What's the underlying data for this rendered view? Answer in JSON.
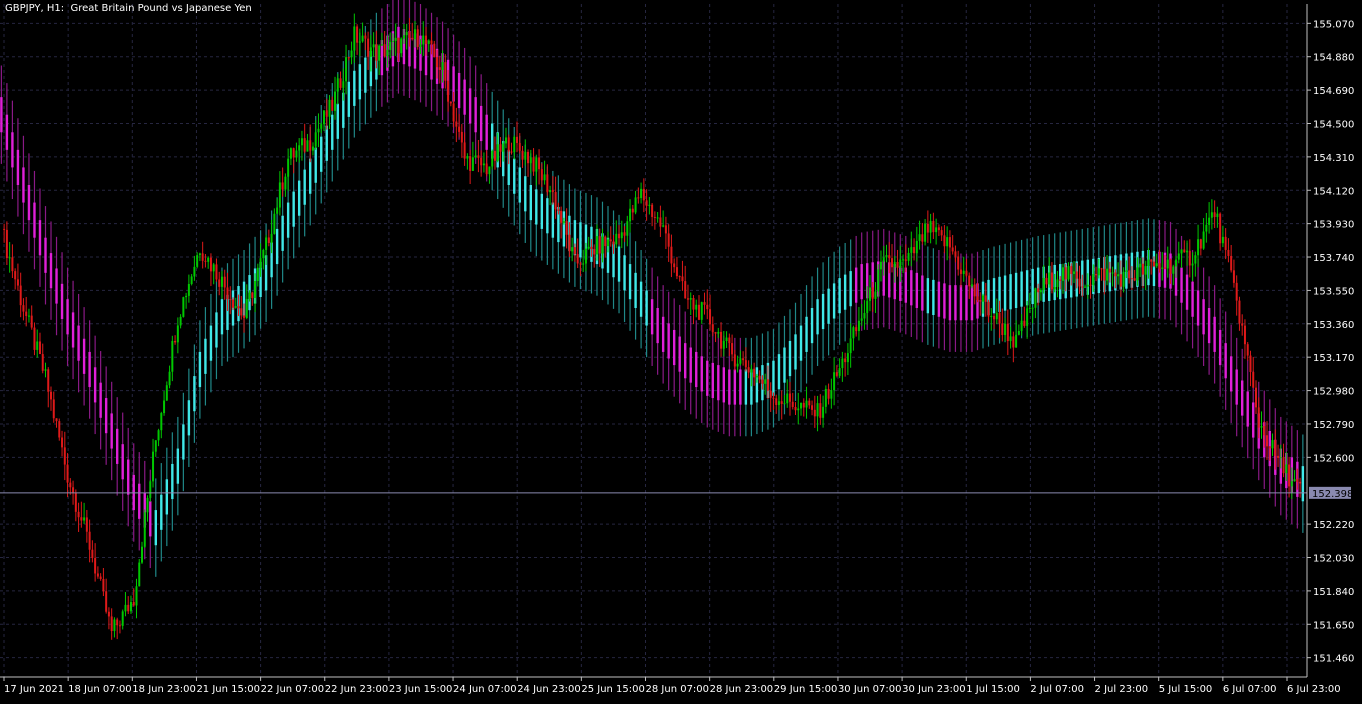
{
  "window": {
    "title": "GBPJPY, H1:  Great Britain Pound vs Japanese Yen"
  },
  "colors": {
    "background": "#000000",
    "axis": "#c0c0c0",
    "grid": "#262640",
    "text": "#ffffff",
    "bull_candle": "#00c800",
    "bear_candle": "#e01a1a",
    "band_up": "#40e8e8",
    "band_down": "#e020d8",
    "band_up_dim": "#208888",
    "band_down_dim": "#8a1a86",
    "price_line": "#8a8ab0",
    "price_label_bg": "#8a8ab0",
    "price_label_text": "#000000"
  },
  "chart_data": {
    "type": "candlestick",
    "symbol": "GBPJPY",
    "timeframe": "H1",
    "description": "Great Britain Pound vs Japanese Yen",
    "grid": true,
    "ylim": [
      151.35,
      155.18
    ],
    "y_ticks": [
      "155.070",
      "154.880",
      "154.690",
      "154.500",
      "154.310",
      "154.120",
      "153.930",
      "153.740",
      "153.550",
      "153.360",
      "153.170",
      "152.980",
      "152.790",
      "152.600",
      "152.220",
      "152.030",
      "151.840",
      "151.650",
      "151.460"
    ],
    "x_ticks": [
      "17 Jun 2021",
      "18 Jun 07:00",
      "18 Jun 23:00",
      "21 Jun 15:00",
      "22 Jun 07:00",
      "22 Jun 23:00",
      "23 Jun 15:00",
      "24 Jun 07:00",
      "24 Jun 23:00",
      "25 Jun 15:00",
      "28 Jun 07:00",
      "28 Jun 23:00",
      "29 Jun 15:00",
      "30 Jun 07:00",
      "30 Jun 23:00",
      "1 Jul 15:00",
      "2 Jul 07:00",
      "2 Jul 23:00",
      "5 Jul 15:00",
      "6 Jul 07:00",
      "6 Jul 23:00"
    ],
    "current_price": "152.398",
    "price_path": [
      [
        0,
        153.9
      ],
      [
        8,
        153.45
      ],
      [
        16,
        153.05
      ],
      [
        24,
        152.5
      ],
      [
        32,
        152.1
      ],
      [
        40,
        151.6
      ],
      [
        48,
        151.8
      ],
      [
        56,
        152.7
      ],
      [
        64,
        153.4
      ],
      [
        72,
        153.8
      ],
      [
        80,
        153.6
      ],
      [
        88,
        153.4
      ],
      [
        96,
        153.8
      ],
      [
        104,
        154.3
      ],
      [
        112,
        154.4
      ],
      [
        120,
        154.6
      ],
      [
        128,
        155.0
      ],
      [
        136,
        154.9
      ],
      [
        144,
        154.95
      ],
      [
        152,
        155.0
      ],
      [
        160,
        154.8
      ],
      [
        168,
        154.3
      ],
      [
        176,
        154.25
      ],
      [
        184,
        154.4
      ],
      [
        192,
        154.3
      ],
      [
        200,
        154.1
      ],
      [
        208,
        153.7
      ],
      [
        216,
        153.8
      ],
      [
        224,
        153.85
      ],
      [
        232,
        154.1
      ],
      [
        240,
        153.9
      ],
      [
        248,
        153.5
      ],
      [
        256,
        153.4
      ],
      [
        264,
        153.2
      ],
      [
        272,
        153.1
      ],
      [
        280,
        152.95
      ],
      [
        288,
        152.9
      ],
      [
        296,
        152.85
      ],
      [
        304,
        153.1
      ],
      [
        312,
        153.4
      ],
      [
        320,
        153.7
      ],
      [
        328,
        153.7
      ],
      [
        336,
        153.9
      ],
      [
        344,
        153.8
      ],
      [
        352,
        153.55
      ],
      [
        360,
        153.4
      ],
      [
        368,
        153.25
      ],
      [
        376,
        153.55
      ],
      [
        384,
        153.65
      ],
      [
        392,
        153.6
      ],
      [
        400,
        153.65
      ],
      [
        408,
        153.62
      ],
      [
        416,
        153.68
      ],
      [
        424,
        153.7
      ],
      [
        432,
        153.75
      ],
      [
        440,
        154.0
      ],
      [
        448,
        153.5
      ],
      [
        456,
        152.8
      ],
      [
        464,
        152.55
      ],
      [
        472,
        152.398
      ]
    ],
    "band_path": [
      [
        0,
        154.55
      ],
      [
        8,
        154.15
      ],
      [
        16,
        153.75
      ],
      [
        24,
        153.4
      ],
      [
        32,
        153.1
      ],
      [
        40,
        152.75
      ],
      [
        48,
        152.4
      ],
      [
        56,
        152.2
      ],
      [
        64,
        152.55
      ],
      [
        72,
        153.1
      ],
      [
        80,
        153.4
      ],
      [
        88,
        153.5
      ],
      [
        96,
        153.65
      ],
      [
        104,
        153.95
      ],
      [
        112,
        154.2
      ],
      [
        120,
        154.45
      ],
      [
        128,
        154.7
      ],
      [
        136,
        154.85
      ],
      [
        144,
        154.95
      ],
      [
        152,
        154.9
      ],
      [
        160,
        154.8
      ],
      [
        168,
        154.65
      ],
      [
        176,
        154.45
      ],
      [
        184,
        154.25
      ],
      [
        192,
        154.05
      ],
      [
        200,
        153.95
      ],
      [
        208,
        153.85
      ],
      [
        216,
        153.8
      ],
      [
        224,
        153.7
      ],
      [
        232,
        153.5
      ],
      [
        240,
        153.3
      ],
      [
        248,
        153.15
      ],
      [
        256,
        153.05
      ],
      [
        264,
        153.0
      ],
      [
        272,
        153.0
      ],
      [
        280,
        153.05
      ],
      [
        288,
        153.2
      ],
      [
        296,
        153.4
      ],
      [
        304,
        153.52
      ],
      [
        312,
        153.6
      ],
      [
        320,
        153.62
      ],
      [
        328,
        153.58
      ],
      [
        336,
        153.52
      ],
      [
        344,
        153.48
      ],
      [
        352,
        153.48
      ],
      [
        360,
        153.52
      ],
      [
        368,
        153.55
      ],
      [
        376,
        153.58
      ],
      [
        384,
        153.6
      ],
      [
        392,
        153.62
      ],
      [
        400,
        153.64
      ],
      [
        408,
        153.66
      ],
      [
        416,
        153.68
      ],
      [
        424,
        153.66
      ],
      [
        432,
        153.5
      ],
      [
        440,
        153.3
      ],
      [
        448,
        153.0
      ],
      [
        456,
        152.75
      ],
      [
        464,
        152.55
      ],
      [
        472,
        152.45
      ]
    ],
    "band_trend_up": [
      [
        56,
        152.0
      ],
      [
        138,
        155.0
      ],
      [
        270,
        153.0
      ],
      [
        310,
        153.6
      ],
      [
        336,
        153.5
      ],
      [
        356,
        153.6
      ],
      [
        400,
        153.7
      ]
    ],
    "band_trend_down": [
      [
        0,
        56
      ],
      [
        138,
        178
      ],
      [
        236,
        270
      ],
      [
        310,
        336
      ],
      [
        340,
        356
      ],
      [
        420,
        472
      ]
    ]
  }
}
